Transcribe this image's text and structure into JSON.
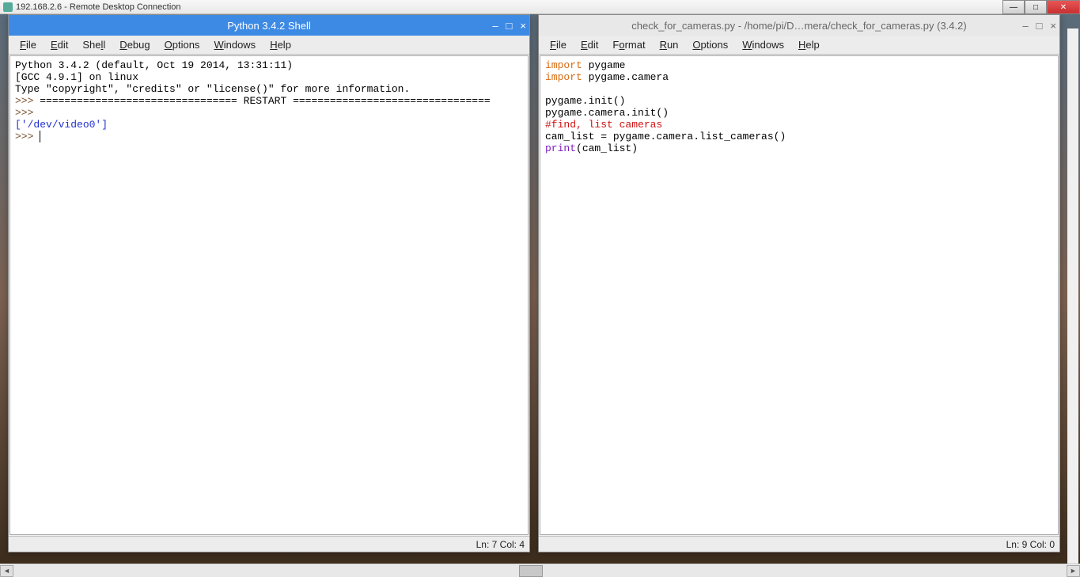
{
  "outer": {
    "title": "192.168.2.6 - Remote Desktop Connection"
  },
  "left_window": {
    "title": "Python 3.4.2 Shell",
    "menus": [
      "File",
      "Edit",
      "Shell",
      "Debug",
      "Options",
      "Windows",
      "Help"
    ],
    "lines": {
      "l1": "Python 3.4.2 (default, Oct 19 2014, 13:31:11)",
      "l2": "[GCC 4.9.1] on linux",
      "l3": "Type \"copyright\", \"credits\" or \"license()\" for more information.",
      "p1": ">>> ",
      "restart": "================================ RESTART ================================",
      "p2": ">>> ",
      "out": "['/dev/video0']",
      "p3": ">>> "
    },
    "status": "Ln: 7 Col: 4"
  },
  "right_window": {
    "title": "check_for_cameras.py - /home/pi/D…mera/check_for_cameras.py (3.4.2)",
    "menus": [
      "File",
      "Edit",
      "Format",
      "Run",
      "Options",
      "Windows",
      "Help"
    ],
    "code": {
      "import": "import",
      "pygame": " pygame",
      "pygame_camera": " pygame.camera",
      "blank": "",
      "init1": "pygame.init()",
      "init2": "pygame.camera.init()",
      "comment": "#find, list cameras",
      "camlist": "cam_list = pygame.camera.list_cameras()",
      "print": "print",
      "print_args": "(cam_list)"
    },
    "status": "Ln: 9 Col: 0"
  }
}
